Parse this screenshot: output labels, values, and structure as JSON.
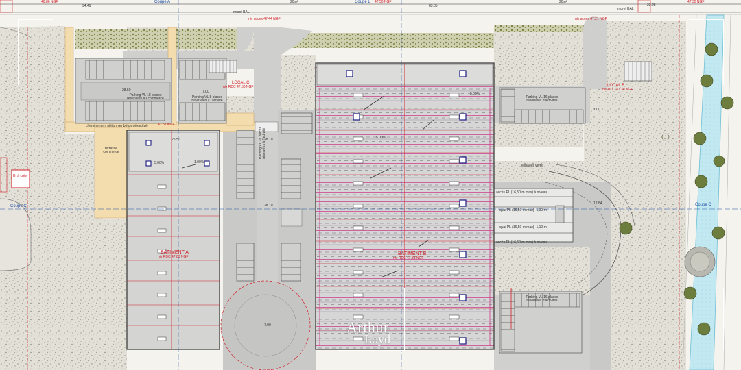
{
  "sections": {
    "coupe_a": "Coupe A",
    "coupe_b": "Coupe B",
    "coupe_b_ngf": "47.50 NGF",
    "coupe_c_left": "Coupe C",
    "coupe_c_right": "Coupe C"
  },
  "levels": {
    "top_left": "46.86 NGF",
    "top_right": "47.30 NGF",
    "access_1": "niv acces 47.44 NGF",
    "access_2": "niv acces 47.21 NGF",
    "cheminement": "47.61 NGF"
  },
  "dims": {
    "d1": "94.49",
    "d2": "83.85",
    "d3": "23.28",
    "d4": "20m²",
    "d5": "20m²",
    "d6": "28.50",
    "d7": "25.50",
    "d8": "7.00",
    "d9": "7.00",
    "d10": "28.10",
    "d11": "28.10",
    "d12": "7.00",
    "d13": "12.84"
  },
  "labels": {
    "muret_1": "muret BAL",
    "muret_2": "muret BAL",
    "parking_vl_18": "Parking VL 18 places réservées au commerce",
    "parking_vl_8": "Parking VL 8 places réservées à l'activité",
    "parking_vl_26": "Parking VL 26 places réservées à l'activité",
    "parking_vl_16a": "Parking VL 16 places réservées d'activités",
    "parking_vl_16b": "Parking VL 16 places réservées d'activités",
    "local_c": "LOCAL C",
    "local_c_niv": "niv RDC 47.30 NGF",
    "local_b": "LOCAL B",
    "local_b_niv": "niv RDC 47.30 NGF",
    "cheminement": "cheminement piétonnier béton désactivé",
    "terrasse": "terrasse commerce",
    "batiment_a": "BATIMENT A",
    "batiment_a_niv": "niv RDC 47.83 NGF",
    "batiment_b": "BATIMENT B",
    "batiment_b_niv": "niv RDC 47.83 NGF",
    "acces_pl_1": "accès PL (16,50 m max) à niveau",
    "quai_1": "quai PL (16,50 m max) -1,10 m",
    "quai_2": "quai PL (16,50 m max) -1,10 m",
    "acces_pl_2": "accès PL (16,50 m max) à niveau",
    "bi_creer": "BI à créer",
    "pct_1": "5.00%",
    "pct_2": "1.00%",
    "pct_3": "5.00%",
    "pct_4": "5.00%",
    "espaces_verts": "espaces verts",
    "logo_line1": "Arthur",
    "logo_line2": "Loyd"
  },
  "colors": {
    "red": "#d0202a",
    "blue_section": "#1f4fa3",
    "terrain": "#dedbd2",
    "building": "#d4d4d2",
    "road": "#c9c9c7",
    "cheminement": "#f3dcae",
    "canal": "#b8e3ee",
    "solar_line": "#cc3b8a",
    "tree": "#6d7d3e"
  },
  "icons": {
    "trees": "tree-icon",
    "skylights": "skylight-icon",
    "stairs": "stairs-icon"
  }
}
